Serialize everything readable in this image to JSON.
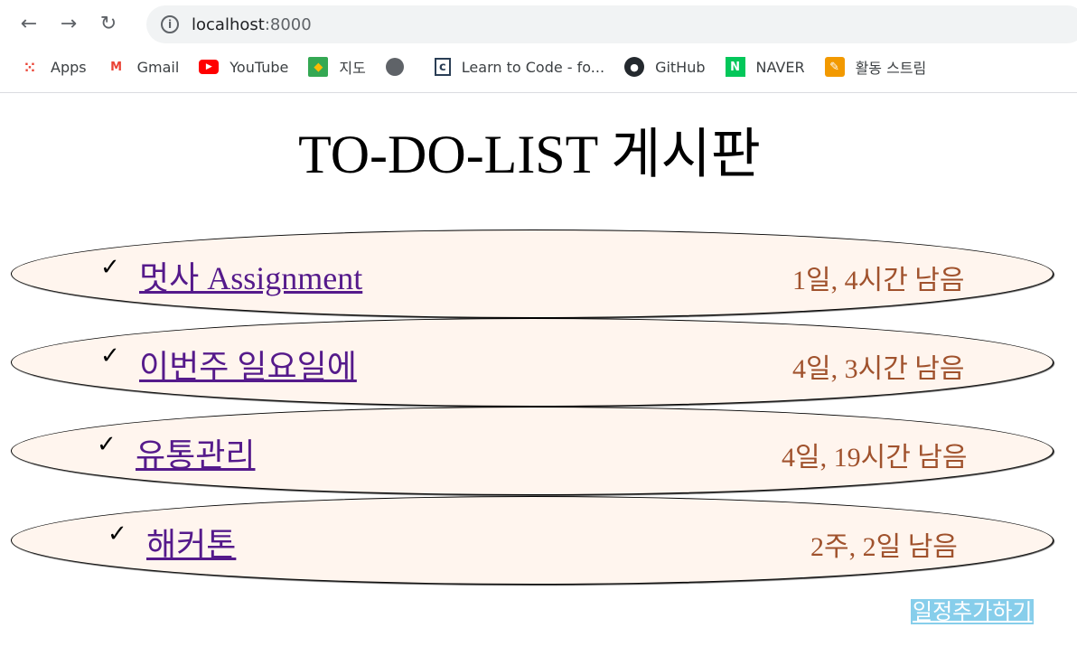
{
  "browser": {
    "url_host": "localhost",
    "url_port": ":8000",
    "bookmarks": [
      {
        "label": "Apps",
        "icon": "apps-grid-icon"
      },
      {
        "label": "Gmail",
        "icon": "gmail-icon"
      },
      {
        "label": "YouTube",
        "icon": "youtube-icon"
      },
      {
        "label": "지도",
        "icon": "maps-icon"
      },
      {
        "label": "",
        "icon": "globe-icon"
      },
      {
        "label": "Learn to Code - fo...",
        "icon": "freecodecamp-icon"
      },
      {
        "label": "GitHub",
        "icon": "github-icon"
      },
      {
        "label": "NAVER",
        "icon": "naver-icon"
      },
      {
        "label": "활동 스트림",
        "icon": "pencil-icon"
      }
    ]
  },
  "page": {
    "title": "TO-DO-LIST 게시판",
    "items": [
      {
        "check": "✓",
        "title": "멋사 Assignment",
        "remaining": "1일, 4시간 남음"
      },
      {
        "check": "✓",
        "title": "이번주 일요일에",
        "remaining": "4일, 3시간 남음"
      },
      {
        "check": "✓",
        "title": "유통관리",
        "remaining": "4일, 19시간 남음"
      },
      {
        "check": "✓",
        "title": "해커톤",
        "remaining": "2주, 2일 남음"
      }
    ],
    "add_button": "일정추가하기"
  },
  "colors": {
    "link": "#551a8b",
    "remaining": "#a0522d",
    "item_bg": "#fff5ee",
    "add_bg": "#87ceeb"
  }
}
